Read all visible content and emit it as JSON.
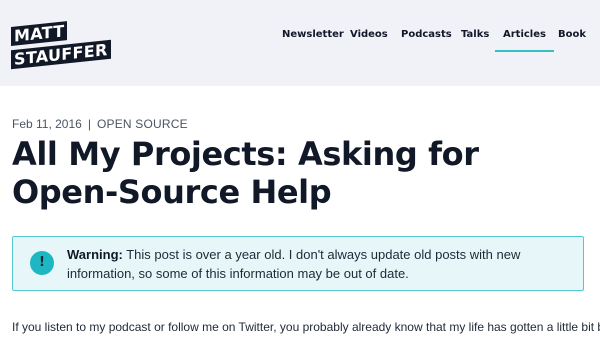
{
  "header": {
    "logo": {
      "line1": "MATT",
      "line2": "STAUFFER"
    },
    "nav": {
      "items": [
        {
          "label": "Newsletter",
          "active": false
        },
        {
          "label": "Videos",
          "active": false
        },
        {
          "label": "Podcasts",
          "active": false
        },
        {
          "label": "Talks",
          "active": false
        },
        {
          "label": "Articles",
          "active": true
        },
        {
          "label": "Book",
          "active": false
        }
      ]
    }
  },
  "post": {
    "date": "Feb 11, 2016",
    "separator": "|",
    "category": "Open Source",
    "title": "All My Projects: Asking for Open-Source Help",
    "warning": {
      "icon": "exclamation-icon",
      "icon_glyph": "!",
      "label": "Warning:",
      "message": " This post is over a year old. I don't always update old posts with new information, so some of this information may be out of date."
    },
    "intro": "If you listen to my podcast or follow me on Twitter, you probably already know that my life has gotten a little bit busier"
  },
  "colors": {
    "header_bg": "#f1f1f8",
    "accent": "#38bdc4",
    "warning_bg": "#e7f7f9",
    "warning_border": "#56c8d0",
    "icon_bg": "#1fb6c3"
  }
}
